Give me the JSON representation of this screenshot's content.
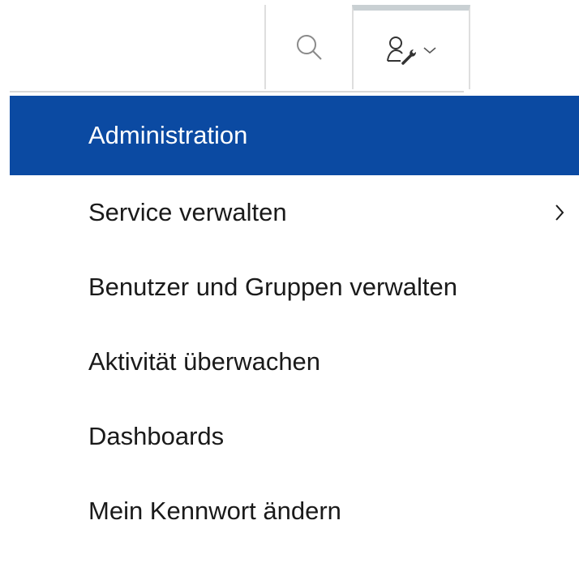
{
  "menu": {
    "header": "Administration",
    "items": [
      {
        "label": "Service verwalten",
        "has_submenu": true
      },
      {
        "label": "Benutzer und Gruppen verwalten"
      },
      {
        "label": "Aktivität überwachen"
      },
      {
        "label": "Dashboards"
      },
      {
        "label": "Mein Kennwort ändern"
      }
    ]
  },
  "icons": {
    "search": "search-icon",
    "user_admin": "user-wrench-icon",
    "dropdown": "chevron-down-icon",
    "submenu": "chevron-right-icon"
  },
  "colors": {
    "header_bg": "#0b4aa2",
    "header_text": "#ffffff",
    "text": "#1a1a1a"
  }
}
